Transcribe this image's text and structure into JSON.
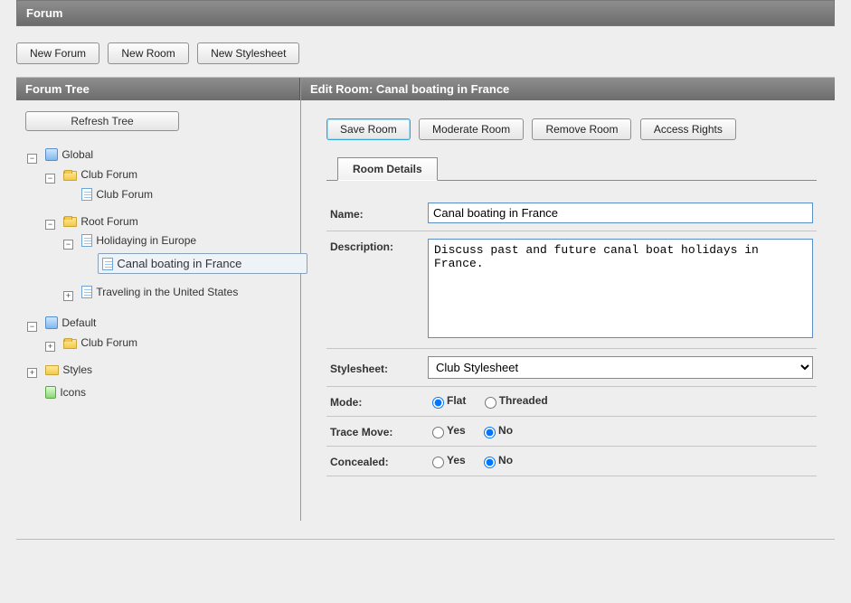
{
  "header": {
    "title": "Forum"
  },
  "toolbar": {
    "new_forum": "New Forum",
    "new_room": "New Room",
    "new_stylesheet": "New Stylesheet"
  },
  "left": {
    "title": "Forum Tree",
    "refresh": "Refresh Tree",
    "tree": {
      "global": "Global",
      "club_forum": "Club Forum",
      "club_forum_page": "Club Forum",
      "root_forum": "Root Forum",
      "holidaying": "Holidaying in Europe",
      "canal": "Canal boating in France",
      "traveling": "Traveling in the United States",
      "default": "Default",
      "default_club": "Club Forum",
      "styles": "Styles",
      "icons": "Icons"
    }
  },
  "right": {
    "title": "Edit Room: Canal boating in France",
    "buttons": {
      "save": "Save Room",
      "moderate": "Moderate Room",
      "remove": "Remove Room",
      "access": "Access Rights"
    },
    "tab": "Room Details",
    "labels": {
      "name": "Name:",
      "description": "Description:",
      "stylesheet": "Stylesheet:",
      "mode": "Mode:",
      "trace": "Trace Move:",
      "concealed": "Concealed:"
    },
    "values": {
      "name": "Canal boating in France",
      "description": "Discuss past and future canal boat holidays in France.",
      "stylesheet_selected": "Club Stylesheet"
    },
    "options": {
      "mode": {
        "flat": "Flat",
        "threaded": "Threaded",
        "selected": "flat"
      },
      "trace": {
        "yes": "Yes",
        "no": "No",
        "selected": "no"
      },
      "concealed": {
        "yes": "Yes",
        "no": "No",
        "selected": "no"
      }
    }
  }
}
